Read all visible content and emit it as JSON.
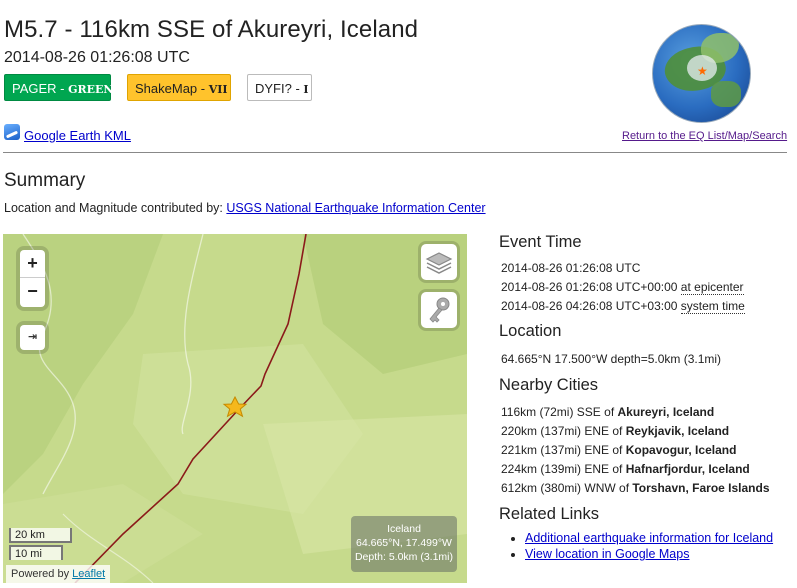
{
  "header": {
    "title": "M5.7 - 116km SSE of Akureyri, Iceland",
    "datetime": "2014-08-26 01:26:08 UTC",
    "badges": {
      "pager_label": "PAGER - ",
      "pager_value": "GREEN",
      "shakemap_label": "ShakeMap - ",
      "shakemap_value": "VII",
      "dyfi_label": "DYFI? - ",
      "dyfi_value": "I"
    },
    "kml_link": "Google Earth KML",
    "return_link": "Return to the EQ List/Map/Search",
    "colors": {
      "pager": "#00a650",
      "shakemap": "#ffc32c"
    }
  },
  "summary": {
    "heading": "Summary",
    "contrib_text": "Location and Magnitude contributed by: ",
    "contrib_link": "USGS National Earthquake Information Center"
  },
  "map": {
    "zoom_in": "+",
    "zoom_out": "−",
    "locate_symbol": "⇥",
    "scale_km": "20 km",
    "scale_mi": "10 mi",
    "attribution_prefix": "Powered by ",
    "attribution_link": "Leaflet",
    "epicenter_box": {
      "place": "Iceland",
      "coords": "64.665°N, 17.499°W",
      "depth": "Depth: 5.0km (3.1mi)"
    }
  },
  "event_time": {
    "heading": "Event Time",
    "utc": "2014-08-26 01:26:08 UTC",
    "epicenter_time": "2014-08-26 01:26:08 UTC+00:00 ",
    "epicenter_label": "at epicenter",
    "system_time": "2014-08-26 04:26:08 UTC+03:00 ",
    "system_label": "system time"
  },
  "location": {
    "heading": "Location",
    "text": "64.665°N 17.500°W depth=5.0km (3.1mi)"
  },
  "nearby_cities": {
    "heading": "Nearby Cities",
    "items": [
      {
        "dist": "116km (72mi) SSE of ",
        "city": "Akureyri, Iceland"
      },
      {
        "dist": "220km (137mi) ENE of ",
        "city": "Reykjavik, Iceland"
      },
      {
        "dist": "221km (137mi) ENE of ",
        "city": "Kopavogur, Iceland"
      },
      {
        "dist": "224km (139mi) ENE of ",
        "city": "Hafnarfjordur, Iceland"
      },
      {
        "dist": "612km (380mi) WNW of ",
        "city": "Torshavn, Faroe Islands"
      }
    ]
  },
  "related_links": {
    "heading": "Related Links",
    "items": [
      "Additional earthquake information for Iceland",
      "View location in Google Maps"
    ]
  }
}
